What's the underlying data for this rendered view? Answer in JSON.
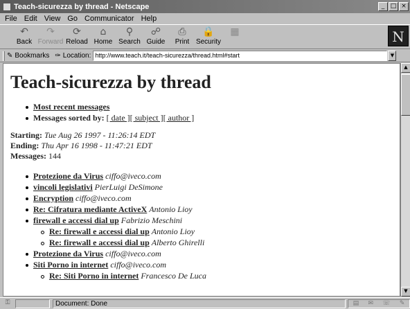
{
  "window": {
    "title": "Teach-sicurezza by thread - Netscape",
    "controls": [
      "_",
      "□",
      "×"
    ]
  },
  "menu": [
    "File",
    "Edit",
    "View",
    "Go",
    "Communicator",
    "Help"
  ],
  "toolbar": [
    {
      "label": "Back",
      "icon": "back-arrow-icon",
      "glyph": "↶",
      "disabled": false
    },
    {
      "label": "Forward",
      "icon": "forward-arrow-icon",
      "glyph": "↷",
      "disabled": true
    },
    {
      "label": "Reload",
      "icon": "reload-icon",
      "glyph": "⟳",
      "disabled": false
    },
    {
      "label": "Home",
      "icon": "home-icon",
      "glyph": "⌂",
      "disabled": false
    },
    {
      "label": "Search",
      "icon": "search-icon",
      "glyph": "⚲",
      "disabled": false
    },
    {
      "label": "Guide",
      "icon": "guide-icon",
      "glyph": "☍",
      "disabled": false
    },
    {
      "label": "Print",
      "icon": "print-icon",
      "glyph": "⎙",
      "disabled": false
    },
    {
      "label": "Security",
      "icon": "security-icon",
      "glyph": "🔒",
      "disabled": false
    },
    {
      "label": "",
      "icon": "stop-icon",
      "glyph": "▦",
      "disabled": true
    }
  ],
  "logo": "N",
  "location_bar": {
    "bookmarks_label": "Bookmarks",
    "location_label": "Location:",
    "url": "http://www.teach.it/teach-sicurezza/thread.html#start"
  },
  "page": {
    "heading": "Teach-sicurezza by thread",
    "nav": {
      "recent": "Most recent messages",
      "sorted_label": "Messages sorted by:",
      "sort_links": [
        "[ date ]",
        "[ subject ]",
        "[ author ]"
      ]
    },
    "meta": {
      "starting_label": "Starting:",
      "starting_value": "Tue Aug 26 1997 - 11:26:14 EDT",
      "ending_label": "Ending:",
      "ending_value": "Thu Apr 16 1998 - 11:47:21 EDT",
      "messages_label": "Messages:",
      "messages_value": "144"
    },
    "threads": [
      {
        "subject": "Protezione da Virus",
        "author": "ciffo@iveco.com",
        "level": 0
      },
      {
        "subject": "vincoli legislativi",
        "author": "PierLuigi DeSimone",
        "level": 0
      },
      {
        "subject": "Encryption",
        "author": "ciffo@iveco.com",
        "level": 0
      },
      {
        "subject": "Re: Cifratura mediante ActiveX",
        "author": "Antonio Lioy",
        "level": 0
      },
      {
        "subject": "firewall e accessi dial up",
        "author": "Fabrizio Meschini",
        "level": 0
      },
      {
        "subject": "Re: firewall e accessi dial up",
        "author": "Antonio Lioy",
        "level": 1
      },
      {
        "subject": "Re: firewall e accessi dial up",
        "author": "Alberto Ghirelli",
        "level": 1
      },
      {
        "subject": "Protezione da Virus",
        "author": "ciffo@iveco.com",
        "level": 0
      },
      {
        "subject": "Siti Porno in internet",
        "author": "ciffo@iveco.com",
        "level": 0
      },
      {
        "subject": "Re: Siti Porno in internet",
        "author": "Francesco De Luca",
        "level": 1
      }
    ]
  },
  "status": {
    "text": "Document: Done"
  }
}
